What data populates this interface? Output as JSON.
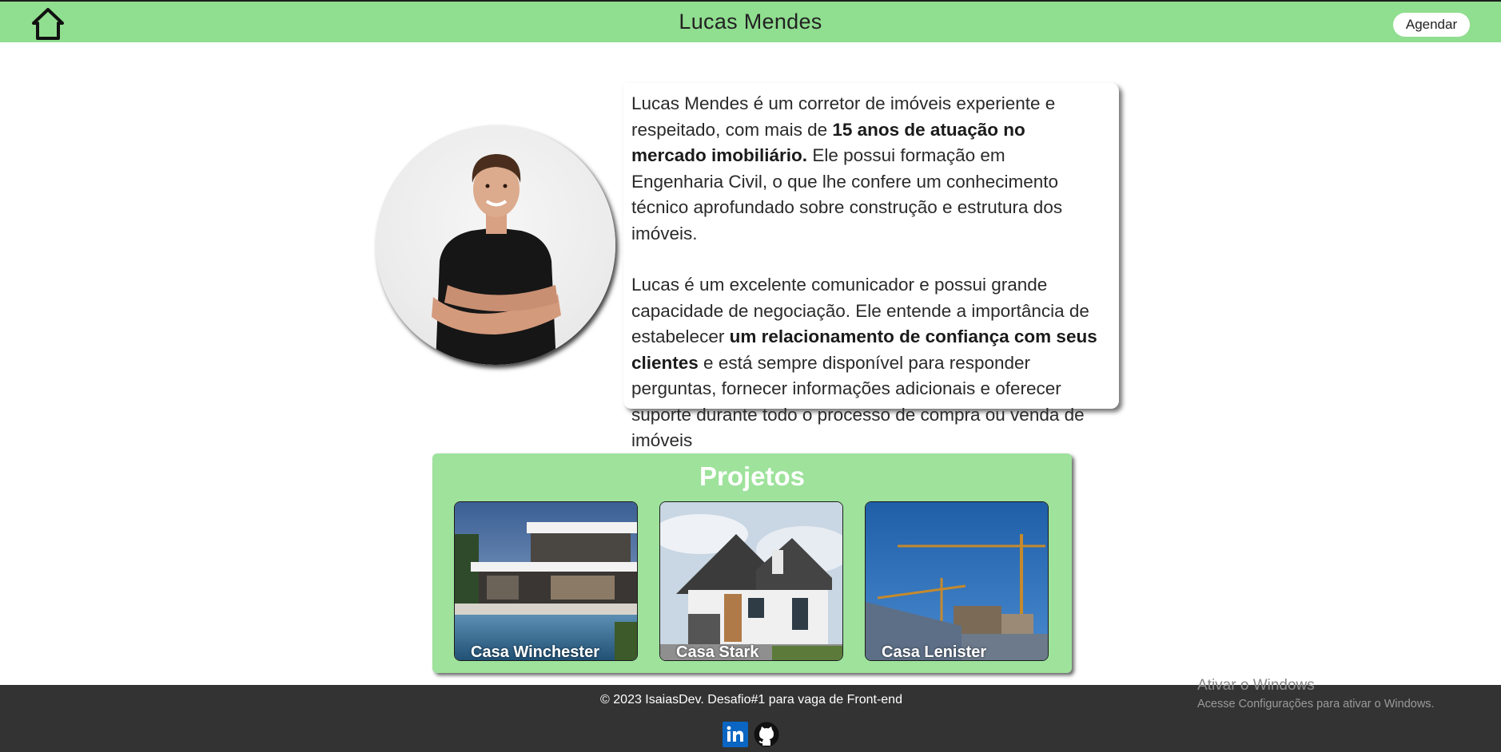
{
  "header": {
    "title": "Lucas Mendes",
    "schedule_label": "Agendar",
    "home_icon": "home-icon"
  },
  "bio": {
    "p1_a": "Lucas Mendes é um corretor de imóveis experiente e respeitado, com mais de ",
    "p1_bold": "15 anos de atuação no mercado imobiliário.",
    "p1_b": " Ele possui formação em Engenharia Civil, o que lhe confere um conhecimento técnico aprofundado sobre construção e estrutura dos imóveis.",
    "p2_a": "Lucas é um excelente comunicador e possui grande capacidade de negociação. Ele entende a importância de estabelecer ",
    "p2_bold": "um relacionamento de confiança com seus clientes",
    "p2_b": " e está sempre disponível para responder perguntas, fornecer informações adicionais e oferecer suporte durante todo o processo de compra ou venda de imóveis"
  },
  "projects": {
    "title": "Projetos",
    "items": [
      {
        "label": "Casa Winchester"
      },
      {
        "label": "Casa Stark"
      },
      {
        "label": "Casa Lenister"
      }
    ]
  },
  "footer": {
    "copyright": "© 2023 IsaiasDev. Desafio#1 para vaga de Front-end",
    "linkedin_icon": "linkedin-icon",
    "github_icon": "github-icon"
  },
  "watermark": {
    "title": "Ativar o Windows",
    "subtitle": "Acesse Configurações para ativar o Windows."
  },
  "colors": {
    "header_bg": "#90de90",
    "projects_bg": "#9ee29c",
    "footer_bg": "#333333",
    "linkedin": "#0a66c2"
  }
}
